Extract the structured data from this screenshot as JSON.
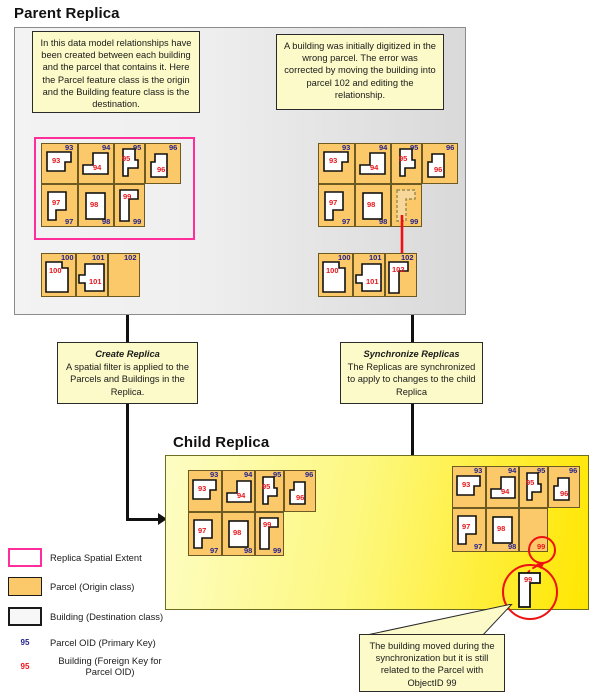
{
  "headings": {
    "parent": "Parent Replica",
    "child": "Child Replica"
  },
  "notes": {
    "data_model": "In this data model relationships have been created between each building and the parcel that contains it. Here the Parcel feature class is the origin and the Building feature class is the destination.",
    "error_fix": "A building was initially digitized in the wrong parcel. The error was corrected by moving the building into parcel 102 and editing the relationship.",
    "create_replica_title": "Create Replica",
    "create_replica_body": "A spatial filter is applied to the Parcels and Buildings in the Replica.",
    "sync_replica_title": "Synchronize Replicas",
    "sync_replica_body": "The Replicas are synchronized to apply to changes to the child Replica",
    "moved_building": "The building moved during the synchronization but it is still related to the Parcel with ObjectID 99"
  },
  "parent_before": {
    "parcel_oids": [
      "93",
      "94",
      "95",
      "96",
      "97",
      "98",
      "99"
    ],
    "building_oids": [
      "93",
      "94",
      "95",
      "96",
      "97",
      "98",
      "99"
    ],
    "lower_parcel_oids": [
      "100",
      "101",
      "102"
    ],
    "lower_building_oids": [
      "100",
      "101"
    ]
  },
  "parent_after": {
    "parcel_oids": [
      "93",
      "94",
      "95",
      "96",
      "97",
      "98",
      "99"
    ],
    "building_oids": [
      "93",
      "94",
      "95",
      "96",
      "97",
      "98"
    ],
    "empty_parcel_oid": "99",
    "lower_parcel_oids": [
      "100",
      "101",
      "102"
    ],
    "lower_building_oids": [
      "100",
      "101",
      "102"
    ]
  },
  "child_before": {
    "parcel_oids": [
      "93",
      "94",
      "95",
      "96",
      "97",
      "98",
      "99"
    ],
    "building_oids": [
      "93",
      "94",
      "95",
      "96",
      "97",
      "98",
      "99"
    ]
  },
  "child_after": {
    "parcel_oids": [
      "93",
      "94",
      "95",
      "96",
      "97",
      "98"
    ],
    "highlight_parcel_oid": "99",
    "building_oids": [
      "93",
      "94",
      "95",
      "96",
      "97",
      "98"
    ],
    "moved_building_oid": "99"
  },
  "legend": {
    "items": [
      {
        "key": "",
        "label": "Replica Spatial Extent",
        "swatch": "extent"
      },
      {
        "key": "",
        "label": "Parcel (Origin class)",
        "swatch": "parcel"
      },
      {
        "key": "",
        "label": "Building (Destination class)",
        "swatch": "building"
      },
      {
        "key": "95",
        "label": "Parcel OID (Primary Key)",
        "swatch": "key-blue"
      },
      {
        "key": "95",
        "label": "Building (Foreign Key for Parcel OID)",
        "swatch": "key-red"
      }
    ]
  },
  "colors": {
    "parcel_fill": "#fbc96a",
    "building_fill": "#ffffff",
    "extent_pink": "#ff2e9a",
    "parcel_oid_blue": "#1f1f8f",
    "building_oid_red": "#e8161b",
    "child_panel_yellow": "#ffe600",
    "note_fill": "#fbfac8",
    "parent_panel_gray": "#efefef"
  }
}
